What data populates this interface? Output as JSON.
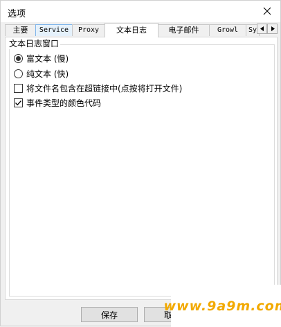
{
  "window": {
    "title": "选项"
  },
  "tabs": [
    {
      "label": "主要"
    },
    {
      "label": "Service"
    },
    {
      "label": "Proxy"
    },
    {
      "label": "文本日志"
    },
    {
      "label": "电子邮件"
    },
    {
      "label": "Growl"
    },
    {
      "label": "Sy"
    }
  ],
  "active_tab": "文本日志",
  "group": {
    "title": "文本日志窗口"
  },
  "options": {
    "rich_text": {
      "label": "富文本 (慢)",
      "selected": true
    },
    "plain_text": {
      "label": "纯文本 (快)",
      "selected": false
    },
    "include_filename": {
      "label": "将文件名包含在超链接中(点按将打开文件)",
      "checked": false
    },
    "color_code": {
      "label": "事件类型的颜色代码",
      "checked": true
    }
  },
  "buttons": {
    "save": "保存",
    "cancel": "取"
  },
  "watermark": "www.9a9m.com",
  "colors": {
    "accent": "#0078d7",
    "watermark": "#f2a900",
    "tab_hover": "#e5f1fb"
  }
}
